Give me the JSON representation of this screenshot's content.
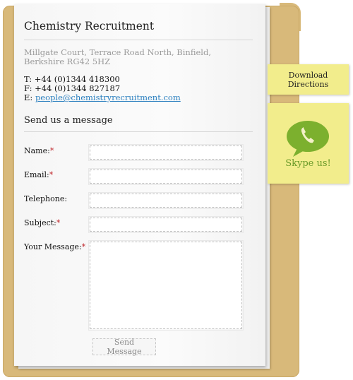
{
  "card": {
    "title": "Chemistry Recruitment",
    "address_line1": "Millgate Court, Terrace Road North, Binfield,",
    "address_line2": "Berkshire RG42 5HZ",
    "phone": "T: +44 (0)1344 418300",
    "fax": "F: +44 (0)1344 827187",
    "email_prefix": "E: ",
    "email": "people@chemistryrecruitment.com"
  },
  "form": {
    "heading": "Send us a message",
    "required_marker": "*",
    "fields": {
      "name": "Name:",
      "email": "Email:",
      "telephone": "Telephone:",
      "subject": "Subject:",
      "message": "Your Message:"
    },
    "values": {
      "name": "",
      "email": "",
      "telephone": "",
      "subject": "",
      "message": ""
    },
    "submit_label": "Send Message"
  },
  "side": {
    "download_line1": "Download",
    "download_line2": "Directions",
    "skype_label": "Skype us!",
    "skype_icon": "phone-speech-bubble-icon"
  },
  "colors": {
    "folder": "#d8b97a",
    "sticky_note": "#f2ed8c",
    "link": "#2a7fbf",
    "required": "#c0282d",
    "skype_green": "#6a9a28"
  }
}
